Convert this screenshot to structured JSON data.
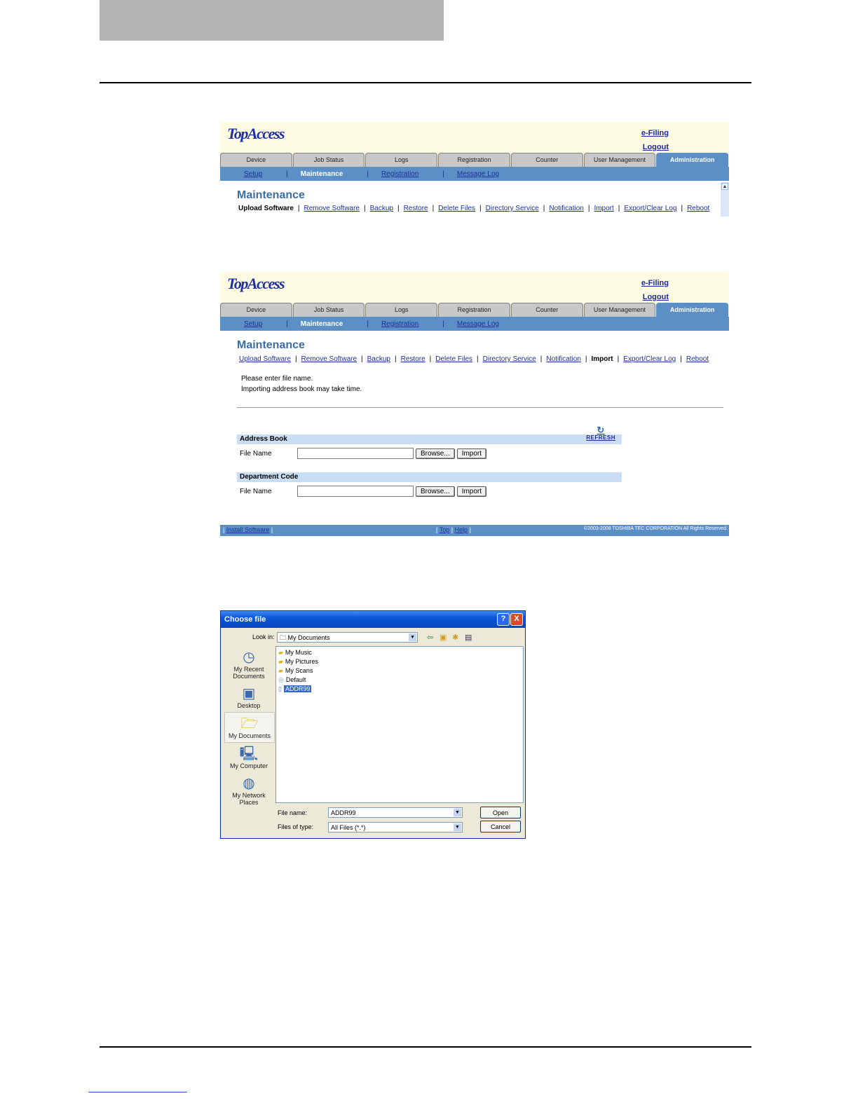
{
  "tabs": [
    "Device",
    "Job Status",
    "Logs",
    "Registration",
    "Counter",
    "User Management",
    "Administration"
  ],
  "subnav": [
    "Setup",
    "Maintenance",
    "Registration",
    "Message Log"
  ],
  "menu": [
    "Upload Software",
    "Remove Software",
    "Backup",
    "Restore",
    "Delete Files",
    "Directory Service",
    "Notification",
    "Import",
    "Export/Clear Log",
    "Reboot"
  ],
  "shot1": {
    "logo": "TopAccess",
    "efiling": "e-Filing",
    "logout": "Logout",
    "title": "Maintenance"
  },
  "shot2": {
    "logo": "TopAccess",
    "efiling": "e-Filing",
    "logout": "Logout",
    "title": "Maintenance",
    "msg1": "Please enter file name.",
    "msg2": "Importing address book may take time.",
    "refresh": "REFRESH",
    "address_book": {
      "header": "Address Book",
      "label": "File Name",
      "browse": "Browse...",
      "import": "Import"
    },
    "department_code": {
      "header": "Department Code",
      "label": "File Name",
      "browse": "Browse...",
      "import": "Import"
    },
    "footer": {
      "install": "Install Software",
      "top": "Top",
      "help": "Help",
      "copyright": "©2003-2008 TOSHIBA TEC CORPORATION All Rights Reserved."
    }
  },
  "dialog": {
    "title": "Choose file",
    "help_btn": "?",
    "close_btn": "X",
    "look_in_label": "Look in:",
    "look_in_value": "My Documents",
    "places": [
      "My Recent Documents",
      "Desktop",
      "My Documents",
      "My Computer",
      "My Network Places"
    ],
    "files": [
      "My Music",
      "My Pictures",
      "My Scans",
      "Default",
      "ADDR99"
    ],
    "file_name_label": "File name:",
    "file_name_value": "ADDR99",
    "file_type_label": "Files of type:",
    "file_type_value": "All Files (*.*)",
    "open": "Open",
    "cancel": "Cancel"
  }
}
